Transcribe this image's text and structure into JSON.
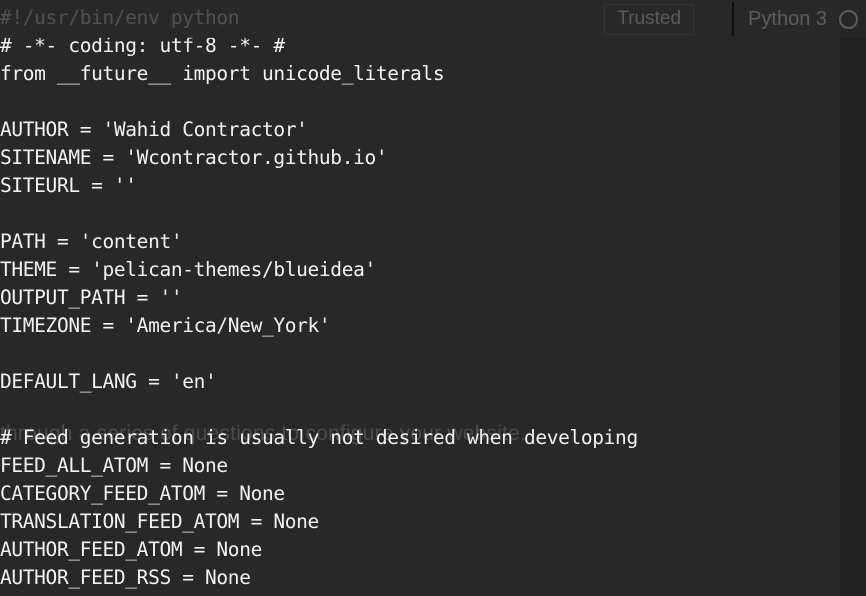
{
  "toolbar": {
    "trusted_label": "Trusted",
    "kernel_name": "Python 3",
    "kernel_status_icon": "circle-idle-icon"
  },
  "editor": {
    "background_color": "#282828",
    "page_background_color": "#222222",
    "text_color": "#f2f2f2",
    "code_lines": [
      "#!/usr/bin/env python",
      "# -*- coding: utf-8 -*- #",
      "from __future__ import unicode_literals",
      "",
      "AUTHOR = 'Wahid Contractor'",
      "SITENAME = 'Wcontractor.github.io'",
      "SITEURL = ''",
      "",
      "PATH = 'content'",
      "THEME = 'pelican-themes/blueidea'",
      "OUTPUT_PATH = ''",
      "TIMEZONE = 'America/New_York'",
      "",
      "DEFAULT_LANG = 'en'",
      "",
      "# Feed generation is usually not desired when developing",
      "FEED_ALL_ATOM = None",
      "CATEGORY_FEED_ATOM = None",
      "TRANSLATION_FEED_ATOM = None",
      "AUTHOR_FEED_ATOM = None",
      "AUTHOR_FEED_RSS = None"
    ]
  },
  "ghost_text": {
    "lines": [
      "through a series of questions to configure your website."
    ]
  }
}
